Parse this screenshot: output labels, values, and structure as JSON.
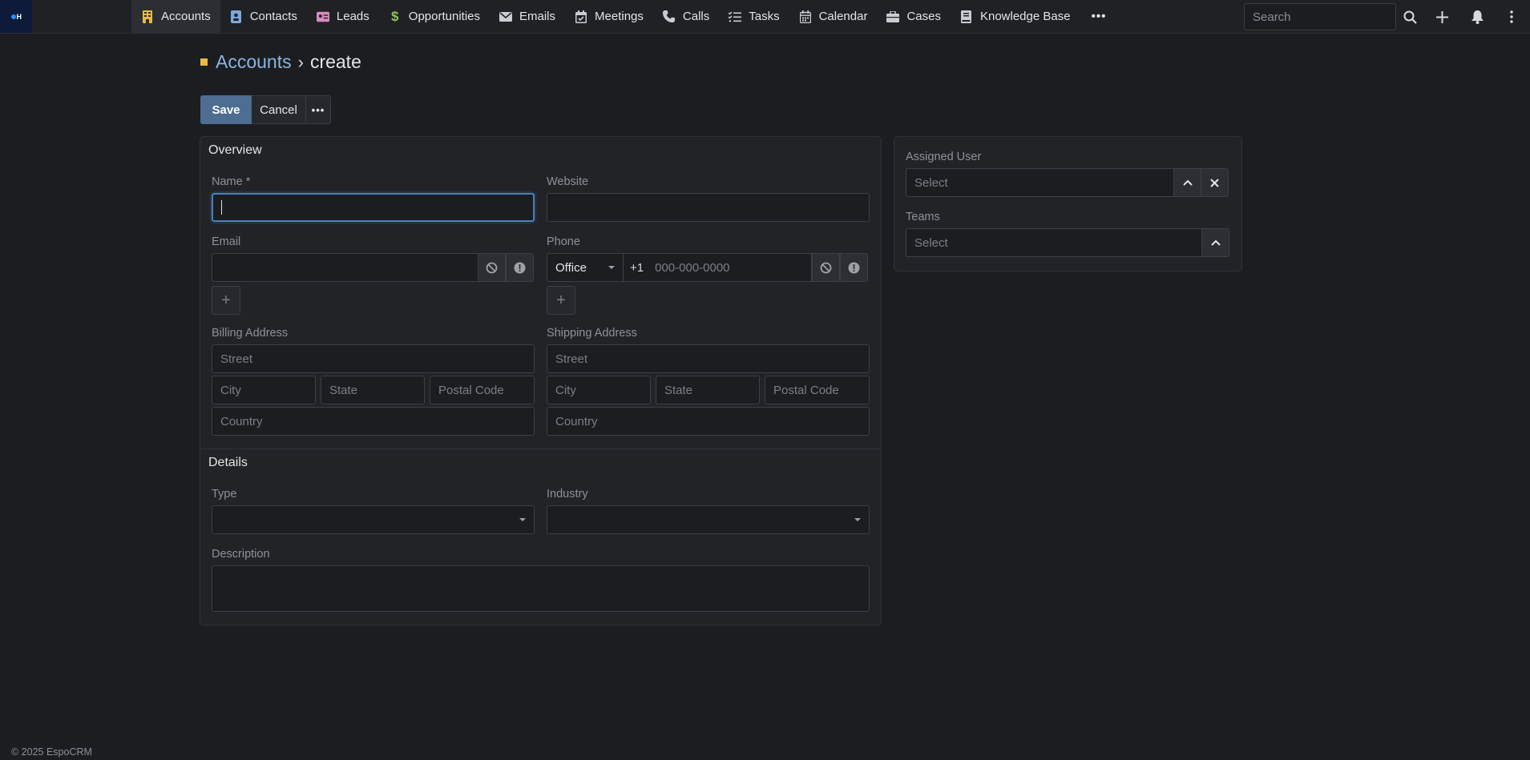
{
  "nav": {
    "items": [
      {
        "label": "Accounts",
        "icon": "building-icon",
        "color": "#e8b948"
      },
      {
        "label": "Contacts",
        "icon": "contact-book-icon",
        "color": "#7fa8d8"
      },
      {
        "label": "Leads",
        "icon": "id-card-icon",
        "color": "#d98ac0"
      },
      {
        "label": "Opportunities",
        "icon": "dollar-icon",
        "color": "#8fc45a"
      },
      {
        "label": "Emails",
        "icon": "envelope-icon",
        "color": "#c9ccd1"
      },
      {
        "label": "Meetings",
        "icon": "calendar-check-icon",
        "color": "#c9ccd1"
      },
      {
        "label": "Calls",
        "icon": "phone-icon",
        "color": "#c9ccd1"
      },
      {
        "label": "Tasks",
        "icon": "tasks-icon",
        "color": "#c9ccd1"
      },
      {
        "label": "Calendar",
        "icon": "calendar-icon",
        "color": "#c9ccd1"
      },
      {
        "label": "Cases",
        "icon": "briefcase-icon",
        "color": "#c9ccd1"
      },
      {
        "label": "Knowledge Base",
        "icon": "book-icon",
        "color": "#c9ccd1"
      }
    ],
    "more_label": "•••",
    "search_placeholder": "Search"
  },
  "header": {
    "breadcrumb_parent": "Accounts",
    "breadcrumb_separator": "›",
    "breadcrumb_current": "create"
  },
  "buttons": {
    "save": "Save",
    "cancel": "Cancel",
    "more": "•••"
  },
  "overview": {
    "title": "Overview",
    "name_label": "Name *",
    "website_label": "Website",
    "email_label": "Email",
    "phone_label": "Phone",
    "phone_type": "Office",
    "phone_code": "+1",
    "phone_placeholder": "000-000-0000",
    "billing_label": "Billing Address",
    "shipping_label": "Shipping Address",
    "street_placeholder": "Street",
    "city_placeholder": "City",
    "state_placeholder": "State",
    "postal_placeholder": "Postal Code",
    "country_placeholder": "Country"
  },
  "details": {
    "title": "Details",
    "type_label": "Type",
    "industry_label": "Industry",
    "description_label": "Description"
  },
  "side": {
    "assigned_user_label": "Assigned User",
    "assigned_user_placeholder": "Select",
    "teams_label": "Teams",
    "teams_placeholder": "Select"
  },
  "footer": {
    "text": "© 2025 EspoCRM"
  }
}
